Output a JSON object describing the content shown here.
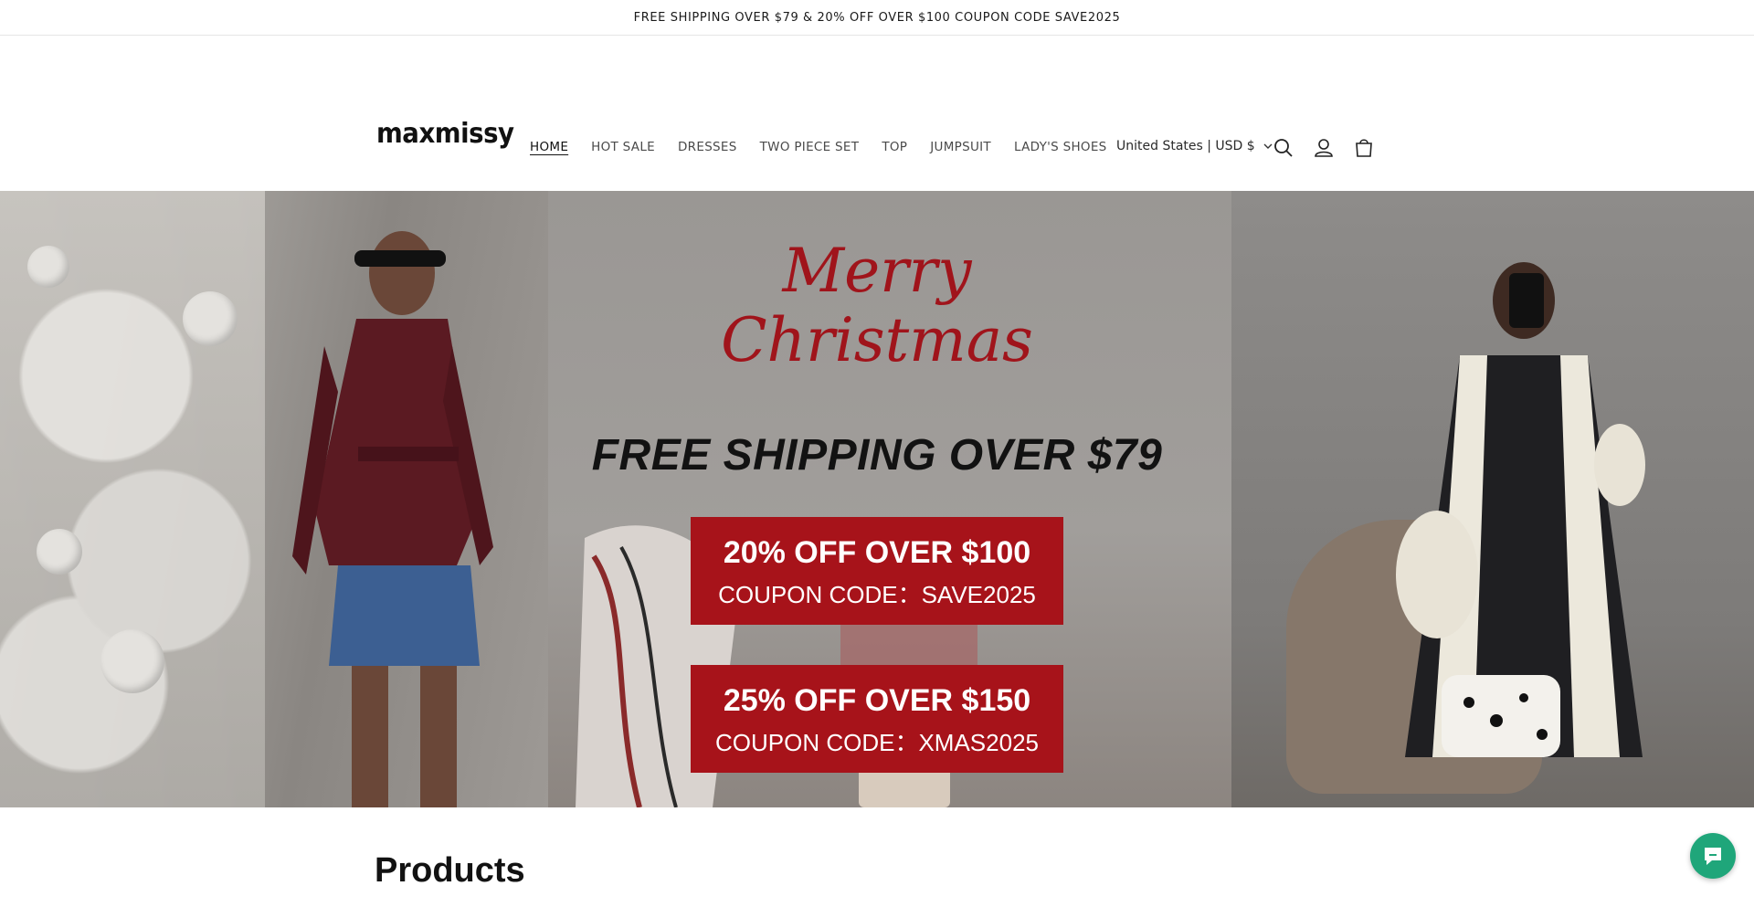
{
  "announcement": {
    "text": "FREE SHIPPING OVER $79 & 20% OFF OVER $100 COUPON CODE  SAVE2025"
  },
  "header": {
    "logo": "maxmissy",
    "nav": [
      {
        "label": "HOME",
        "active": true
      },
      {
        "label": "HOT SALE"
      },
      {
        "label": "DRESSES"
      },
      {
        "label": "TWO PIECE SET"
      },
      {
        "label": "TOP"
      },
      {
        "label": "JUMPSUIT"
      },
      {
        "label": "LADY'S SHOES"
      }
    ],
    "localization": "United States | USD $",
    "icons": [
      "search-icon",
      "account-icon",
      "cart-icon"
    ]
  },
  "hero": {
    "line1": "Merry",
    "line2": "Christmas",
    "free_shipping": "FREE SHIPPING OVER $79",
    "coupons": [
      {
        "headline": "20% OFF OVER $100",
        "code": "COUPON CODE：SAVE2025"
      },
      {
        "headline": "25% OFF OVER $150",
        "code": "COUPON CODE：XMAS2025"
      }
    ]
  },
  "sections": {
    "products_title": "Products"
  },
  "colors": {
    "accent_red": "#a7131a",
    "chat_green": "#1fa67a"
  }
}
